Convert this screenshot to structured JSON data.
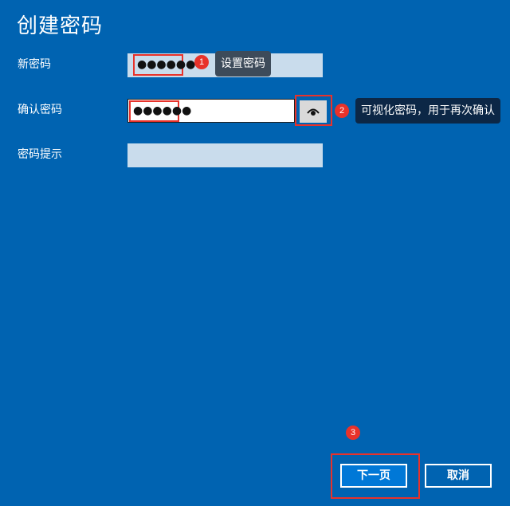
{
  "header": {
    "title": "创建密码"
  },
  "form": {
    "new_password": {
      "label": "新密码",
      "value": "●●●●●●"
    },
    "confirm_password": {
      "label": "确认密码",
      "value": "●●●●●●"
    },
    "hint": {
      "label": "密码提示",
      "value": ""
    }
  },
  "annotations": {
    "badge1": "1",
    "tip1": "设置密码",
    "badge2": "2",
    "tip2": "可视化密码，用于再次确认",
    "badge3": "3"
  },
  "buttons": {
    "next": "下一页",
    "cancel": "取消"
  },
  "icons": {
    "reveal": "eye-icon"
  },
  "colors": {
    "background": "#0063b1",
    "annotation": "#e8322a",
    "primary": "#0078d7"
  }
}
